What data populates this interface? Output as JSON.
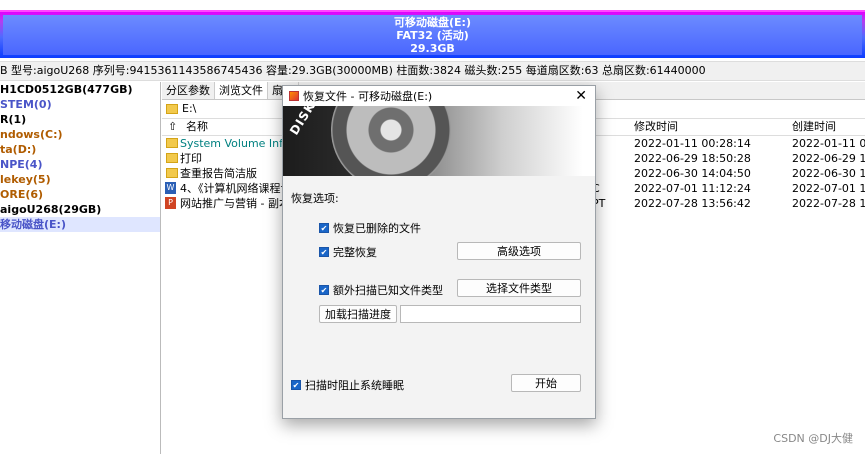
{
  "disk_bar": {
    "line1": "可移动磁盘(E:)",
    "line2": "FAT32 (活动)",
    "line3": "29.3GB"
  },
  "info_line": "B  型号:aigoU268  序列号:9415361143586745436  容量:29.3GB(30000MB)  柱面数:3824  磁头数:255  每道扇区数:63  总扇区数:61440000",
  "tree": [
    {
      "label": "H1CD0512GB(477GB)",
      "color": "#000000"
    },
    {
      "label": "STEM(0)",
      "color": "#4a55c8"
    },
    {
      "label": "R(1)",
      "color": "#000000"
    },
    {
      "label": "ndows(C:)",
      "color": "#b05c00"
    },
    {
      "label": "ta(D:)",
      "color": "#b05c00"
    },
    {
      "label": "NPE(4)",
      "color": "#4a55c8"
    },
    {
      "label": "lekey(5)",
      "color": "#b05c00"
    },
    {
      "label": "ORE(6)",
      "color": "#b05c00"
    },
    {
      "label": "aigoU268(29GB)",
      "color": "#000000"
    },
    {
      "label": "移动磁盘(E:)",
      "color": "#4a55c8"
    }
  ],
  "tabs": [
    "分区参数",
    "浏览文件",
    "扇区"
  ],
  "path": "E:\\",
  "columns": {
    "name": "名称",
    "modified": "修改时间",
    "created": "创建时间"
  },
  "files": [
    {
      "name": "System Volume Infor",
      "ext": "",
      "modified": "2022-01-11 00:28:14",
      "created": "2022-01-11 00:",
      "color": "#008080",
      "icon": "folder-icon"
    },
    {
      "name": "打印",
      "ext": "",
      "modified": "2022-06-29 18:50:28",
      "created": "2022-06-29 18:",
      "color": "#000000",
      "icon": "folder-icon"
    },
    {
      "name": "查重报告简洁版",
      "ext": "",
      "modified": "2022-06-30 14:04:50",
      "created": "2022-06-30 14:",
      "color": "#000000",
      "icon": "folder-icon"
    },
    {
      "name": "4、《计算机网络课程设",
      "ext": "C",
      "modified": "2022-07-01 11:12:24",
      "created": "2022-07-01 14:",
      "color": "#000000",
      "icon": "word-doc-icon"
    },
    {
      "name": "网站推广与营销 - 副本.",
      "ext": "PT",
      "modified": "2022-07-28 13:56:42",
      "created": "2022-07-28 14:",
      "color": "#000000",
      "icon": "ppt-doc-icon"
    }
  ],
  "dialog": {
    "title": "恢复文件 - 可移动磁盘(E:)",
    "close": "✕",
    "brand": "DISKGENIUS",
    "section": "恢复选项:",
    "opt_deleted": "恢复已删除的文件",
    "opt_full": "完整恢复",
    "btn_advanced": "高级选项",
    "opt_extra": "额外扫描已知文件类型",
    "btn_filetype": "选择文件类型",
    "btn_load": "加载扫描进度",
    "opt_sleep": "扫描时阻止系统睡眠",
    "btn_start": "开始"
  },
  "watermark": "CSDN @DJ大健"
}
